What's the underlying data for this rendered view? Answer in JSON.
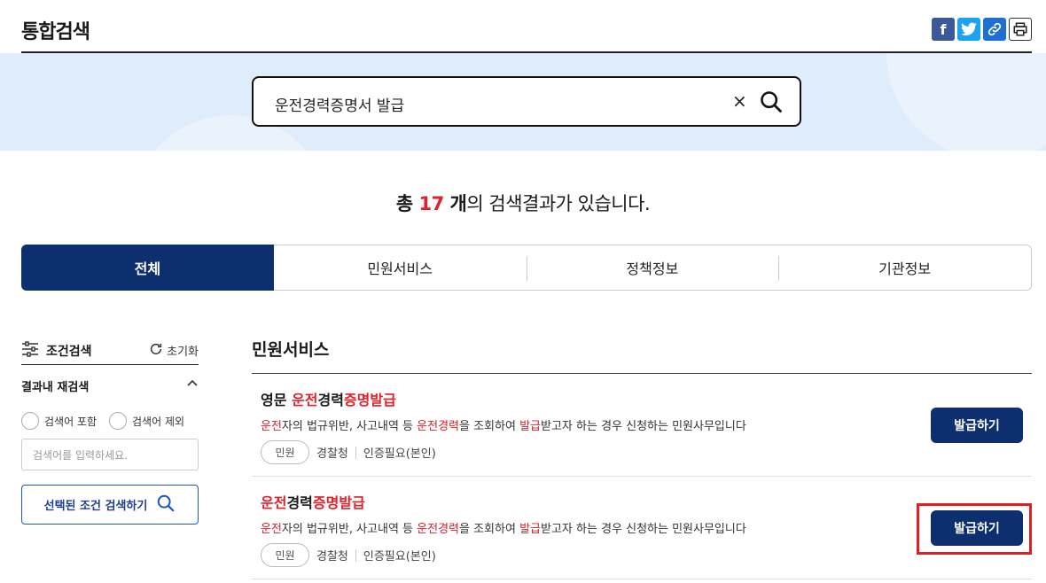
{
  "header": {
    "title": "통합검색"
  },
  "share": {
    "facebook_icon": "f",
    "twitter_icon": "t",
    "link_icon": "⛓",
    "print_icon": "⎙"
  },
  "search": {
    "query": "운전경력증명서 발급",
    "clear_label": "×"
  },
  "result_summary": {
    "prefix": "총 ",
    "count": "17",
    "unit": " 개",
    "suffix": "의 검색결과가 있습니다."
  },
  "tabs": [
    {
      "label": "전체",
      "active": true
    },
    {
      "label": "민원서비스"
    },
    {
      "label": "정책정보"
    },
    {
      "label": "기관정보"
    }
  ],
  "sidebar": {
    "filter_label": "조건검색",
    "reset_label": "초기화",
    "research_label": "결과내 재검색",
    "include_label": "검색어 포함",
    "exclude_label": "검색어 제외",
    "input_placeholder": "검색어를 입력하세요.",
    "submit_label": "선택된 조건 검색하기"
  },
  "main": {
    "section_title": "민원서비스",
    "items": [
      {
        "name_parts": [
          "영문 ",
          "운전",
          "경력",
          "증명발급"
        ],
        "desc_parts": [
          "운전",
          "자의 법규위반, 사고내역 등 ",
          "운전경력",
          "을 조회하여 ",
          "발급",
          "받고자 하는 경우 신청하는 민원사무입니다"
        ],
        "badge": "민원",
        "org": "경찰청",
        "auth": "인증필요(본인)",
        "button": "발급하기"
      },
      {
        "name_parts": [
          "운전",
          "경력",
          "증명발급"
        ],
        "desc_parts": [
          "운전",
          "자의 법규위반, 사고내역 등 ",
          "운전경력",
          "을 조회하여 ",
          "발급",
          "받고자 하는 경우 신청하는 민원사무입니다"
        ],
        "badge": "민원",
        "org": "경찰청",
        "auth": "인증필요(본인)",
        "button": "발급하기"
      }
    ]
  },
  "colors": {
    "primary": "#0d2f6e",
    "highlight": "#e0202a",
    "band": "#dfecfb"
  }
}
